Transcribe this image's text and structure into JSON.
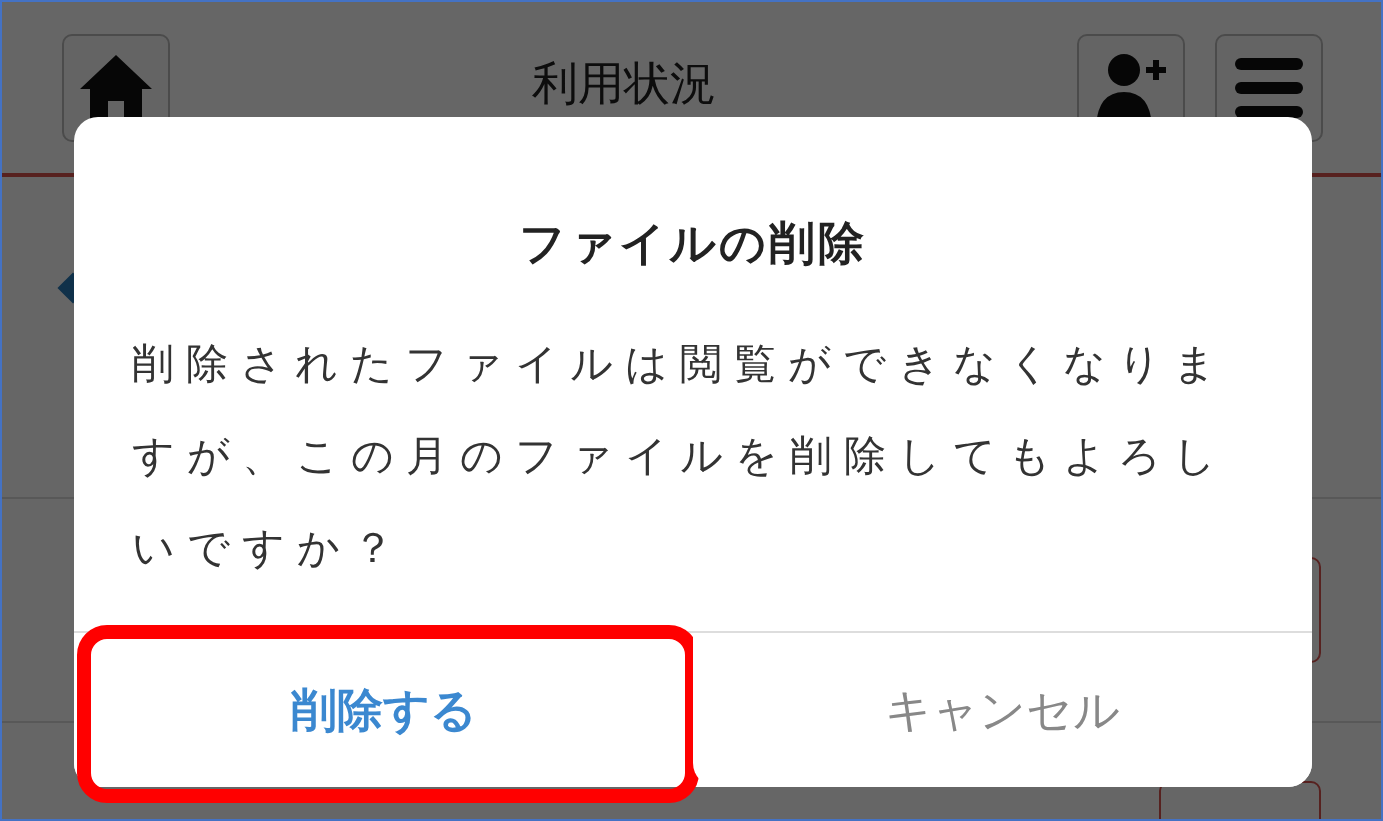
{
  "header": {
    "title": "利用状況"
  },
  "dialog": {
    "title": "ファイルの削除",
    "message": "削除されたファイルは閲覧ができなくなりますが、この月のファイルを削除してもよろしいですか？",
    "buttons": [
      {
        "label": "削除する",
        "kind": "primary",
        "highlighted": true
      },
      {
        "label": "キャンセル",
        "kind": "secondary",
        "highlighted": false
      }
    ]
  }
}
